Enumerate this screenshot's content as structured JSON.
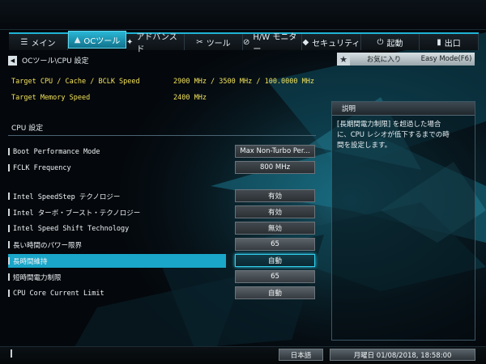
{
  "tabs": [
    {
      "label": "メイン",
      "icon": "list-icon",
      "glyph": "☰"
    },
    {
      "label": "OCツール",
      "icon": "rocket-icon",
      "glyph": "▲"
    },
    {
      "label": "アドバンスド",
      "icon": "star-icon",
      "glyph": "✦"
    },
    {
      "label": "ツール",
      "icon": "wrench-icon",
      "glyph": "✂"
    },
    {
      "label": "H/W モニター",
      "icon": "monitor-icon",
      "glyph": "⊘"
    },
    {
      "label": "セキュリティ",
      "icon": "shield-icon",
      "glyph": "◆"
    },
    {
      "label": "起動",
      "icon": "power-icon",
      "glyph": "⏻"
    },
    {
      "label": "出口",
      "icon": "exit-icon",
      "glyph": "▮"
    }
  ],
  "active_tab": "OCツール",
  "breadcrumb": "OCツール\\CPU 設定",
  "favorites_label": "お気に入り",
  "easy_mode_label": "Easy Mode(F6)",
  "info": [
    {
      "label": "Target CPU / Cache / BCLK Speed",
      "value": "2900 MHz / 3500 MHz / 100.0000 MHz"
    },
    {
      "label": "Target Memory Speed",
      "value": "2400 MHz"
    }
  ],
  "section_title": "CPU 設定",
  "settings": [
    {
      "label": "Boot Performance Mode",
      "value": "Max Non-Turbo Per..."
    },
    {
      "label": "FCLK Frequency",
      "value": "800 MHz"
    },
    {
      "label": "Intel SpeedStep テクノロジー",
      "value": "有効"
    },
    {
      "label": "Intel ターボ・ブースト・テクノロジー",
      "value": "有効"
    },
    {
      "label": "Intel Speed Shift Technology",
      "value": "無効"
    },
    {
      "label": "長い時間のパワー限界",
      "value": "65"
    },
    {
      "label": "長時間維持",
      "value": "自動"
    },
    {
      "label": "短時間電力制限",
      "value": "65"
    },
    {
      "label": "CPU Core Current Limit",
      "value": "自動"
    }
  ],
  "selected_setting": "長時間維持",
  "help": {
    "title": "説明",
    "lines": [
      "[長期間電力制限] を超過した場合",
      "に、CPU レシオが低下するまでの時",
      "間を設定します。"
    ]
  },
  "language_label": "日本語",
  "datetime": "月曜日 01/08/2018, 18:58:00",
  "colors": {
    "accent": "#1aa6c8",
    "info_text": "#f2e25a",
    "background": "#04070b"
  }
}
